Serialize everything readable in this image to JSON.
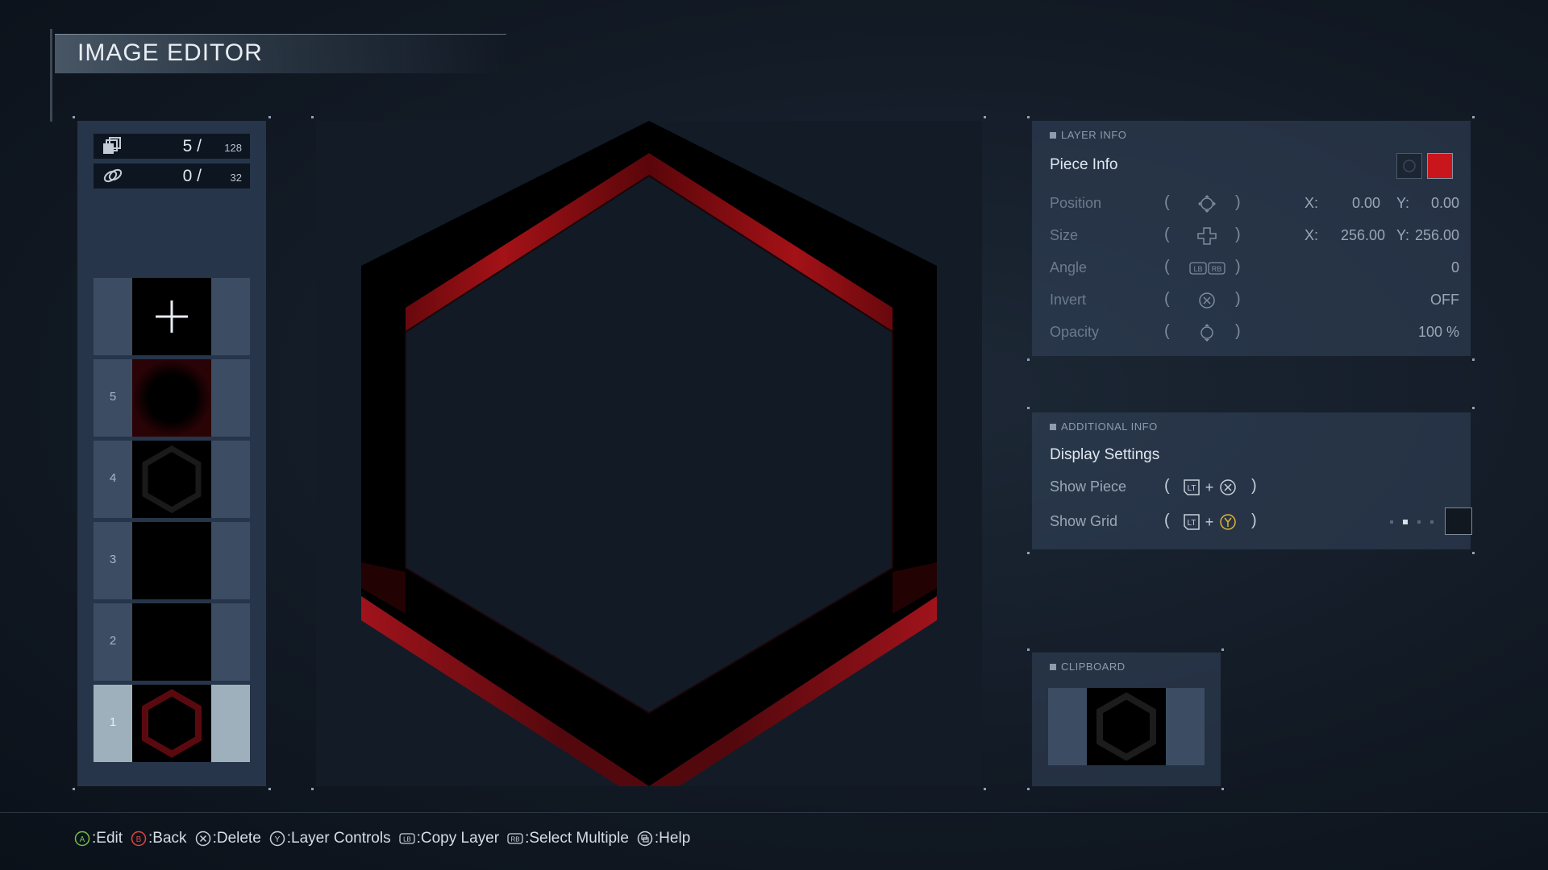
{
  "title": "IMAGE EDITOR",
  "counters": {
    "pieces": {
      "current": "5",
      "max": "128"
    },
    "links": {
      "current": "0",
      "max": "32"
    }
  },
  "layers": [
    {
      "label": "5"
    },
    {
      "label": "4"
    },
    {
      "label": "3"
    },
    {
      "label": "2"
    },
    {
      "label": "1",
      "selected": true
    }
  ],
  "layer_info": {
    "header": "LAYER INFO",
    "subtitle": "Piece Info",
    "rows": {
      "position": {
        "label": "Position",
        "x_label": "X:",
        "x": "0.00",
        "y_label": "Y:",
        "y": "0.00"
      },
      "size": {
        "label": "Size",
        "x_label": "X:",
        "x": "256.00",
        "y_label": "Y:",
        "y": "256.00"
      },
      "angle": {
        "label": "Angle",
        "value": "0"
      },
      "invert": {
        "label": "Invert",
        "value": "OFF"
      },
      "opacity": {
        "label": "Opacity",
        "value": "100 %"
      }
    },
    "color_swatch": "#c8161c"
  },
  "additional_info": {
    "header": "ADDITIONAL INFO",
    "subtitle": "Display Settings",
    "show_piece": {
      "label": "Show Piece",
      "plus": "+"
    },
    "show_grid": {
      "label": "Show Grid",
      "plus": "+"
    }
  },
  "clipboard": {
    "header": "CLIPBOARD"
  },
  "hints": [
    {
      "button": "A",
      "text": ":Edit"
    },
    {
      "button": "B",
      "text": ":Back"
    },
    {
      "button": "X",
      "text": ":Delete"
    },
    {
      "button": "Y",
      "text": ":Layer Controls"
    },
    {
      "button": "LB",
      "text": ":Copy Layer"
    },
    {
      "button": "RB",
      "text": ":Select Multiple"
    },
    {
      "button": "View",
      "text": ":Help"
    }
  ],
  "colors": {
    "accent_red": "#c8161c",
    "panel": "#26354a"
  }
}
